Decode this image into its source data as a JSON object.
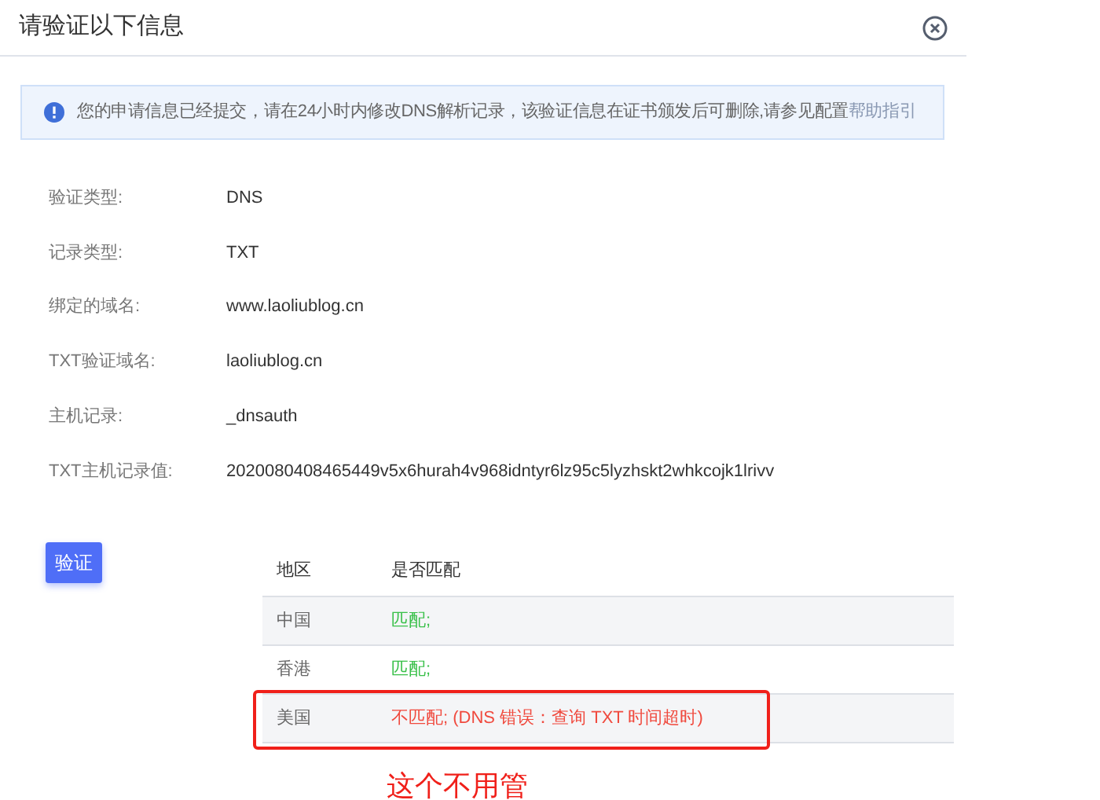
{
  "dialog": {
    "title": "请验证以下信息"
  },
  "notice": {
    "text": "您的申请信息已经提交，请在24小时内修改DNS解析记录，该验证信息在证书颁发后可删除,请参见配置",
    "link": "帮助指引"
  },
  "fields": [
    {
      "label": "验证类型:",
      "value": "DNS"
    },
    {
      "label": "记录类型:",
      "value": "TXT"
    },
    {
      "label": "绑定的域名:",
      "value": "www.laoliublog.cn"
    },
    {
      "label": "TXT验证域名:",
      "value": "laoliublog.cn"
    },
    {
      "label": "主机记录:",
      "value": "_dnsauth"
    },
    {
      "label": "TXT主机记录值:",
      "value": "2020080408465449v5x6hurah4v968idntyr6lz95c5lyzhskt2whkcojk1lrivv"
    }
  ],
  "verify_button": "验证",
  "table": {
    "columns": [
      "地区",
      "是否匹配"
    ],
    "rows": [
      {
        "region": "中国",
        "result": "匹配;",
        "matched": true,
        "highlighted": false
      },
      {
        "region": "香港",
        "result": "匹配;",
        "matched": true,
        "highlighted": false
      },
      {
        "region": "美国",
        "result": "不匹配; (DNS 错误：查询 TXT 时间超时)",
        "matched": false,
        "highlighted": true
      }
    ]
  },
  "annotation": {
    "text": "这个不用管"
  }
}
